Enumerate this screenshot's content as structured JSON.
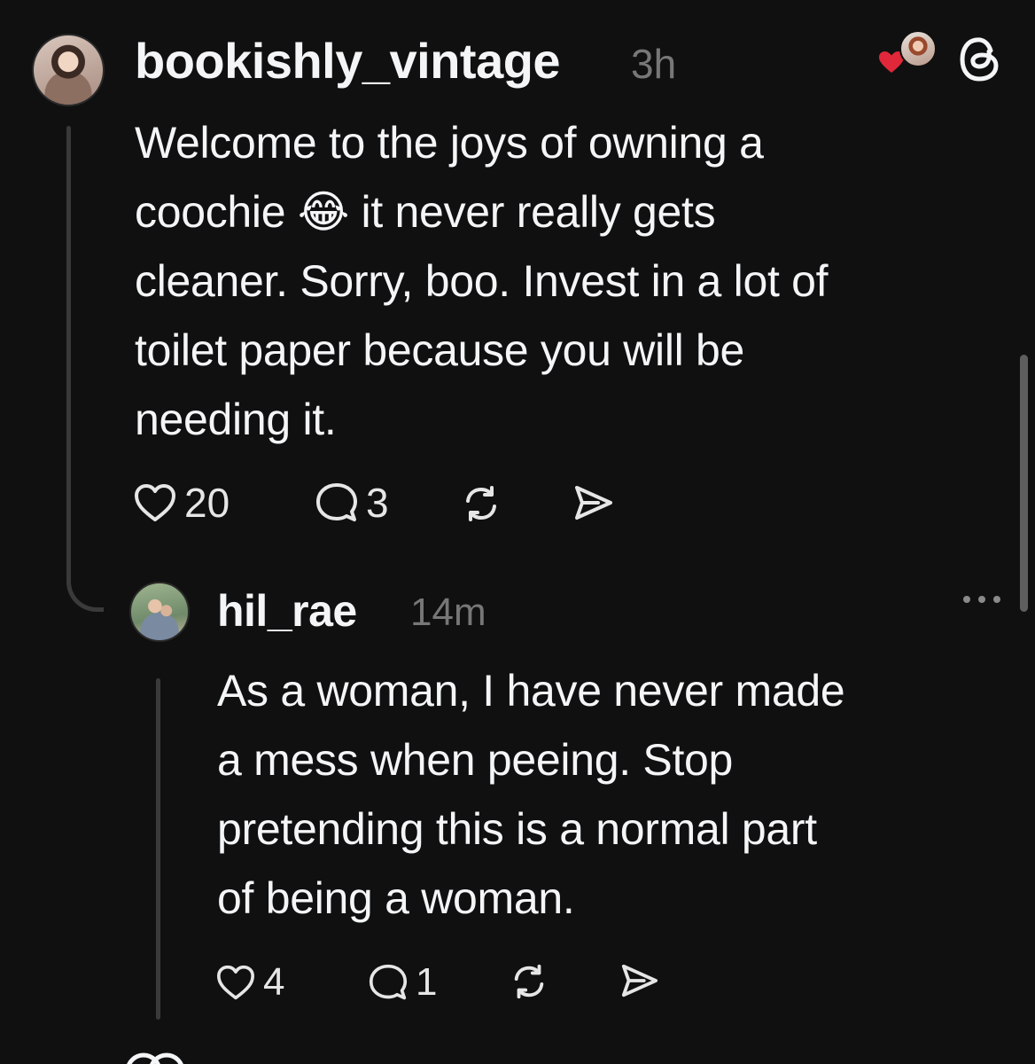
{
  "colors": {
    "background": "#101010",
    "text": "#f3f5f7",
    "muted": "#777777",
    "thread_line": "#3a3a3a",
    "heart_badge": "#e0283a"
  },
  "post": {
    "username": "bookishly_vintage",
    "time": "3h",
    "text": "Welcome to the joys of owning a\ncoochie ",
    "emoji": "😂",
    "text_after_emoji": " it never really gets\ncleaner. Sorry, boo. Invest in a lot of\ntoilet paper because you will be\nneeding it.",
    "likes": "20",
    "replies": "3",
    "icons": {
      "like": "heart-outline-icon",
      "reply": "comment-bubble-icon",
      "repost": "repost-icon",
      "share": "send-icon",
      "threads_logo": "threads-logo-icon",
      "liked_badge": "heart-filled-icon"
    }
  },
  "reply": {
    "username": "hil_rae",
    "time": "14m",
    "text": "As a woman, I have never made\na mess when peeing. Stop\npretending this is a normal part\nof being a woman.",
    "likes": "4",
    "replies": "1",
    "icons": {
      "like": "heart-outline-icon",
      "reply": "comment-bubble-icon",
      "repost": "repost-icon",
      "share": "send-icon",
      "more": "more-options-icon"
    }
  }
}
